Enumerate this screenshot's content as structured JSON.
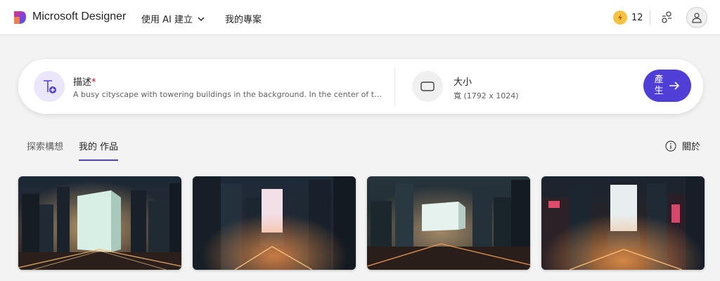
{
  "header": {
    "brand": "Microsoft Designer",
    "nav_create": "使用 AI 建立",
    "nav_projects": "我的專案",
    "credits": "12",
    "icons": {
      "logo": "designer-logo-icon",
      "bolt": "lightning-bolt-icon",
      "share": "share-icon",
      "avatar": "user-avatar-icon"
    }
  },
  "prompt": {
    "label": "描述",
    "required_mark": "*",
    "text": "A busy cityscape with towering buildings in the background. In the center of the image",
    "size_label": "大小",
    "size_value": "寬 (1792 x 1024)",
    "generate_label": "產生"
  },
  "tabs": [
    {
      "label": "探索構想",
      "active": false
    },
    {
      "label": "我的 作品",
      "active": true
    }
  ],
  "about_label": "關於",
  "gallery": {
    "items": [
      {
        "alt": "cityscape-1"
      },
      {
        "alt": "cityscape-2"
      },
      {
        "alt": "cityscape-3"
      },
      {
        "alt": "cityscape-4"
      }
    ]
  },
  "colors": {
    "accent": "#4f3fd6",
    "bolt": "#f5c242"
  }
}
